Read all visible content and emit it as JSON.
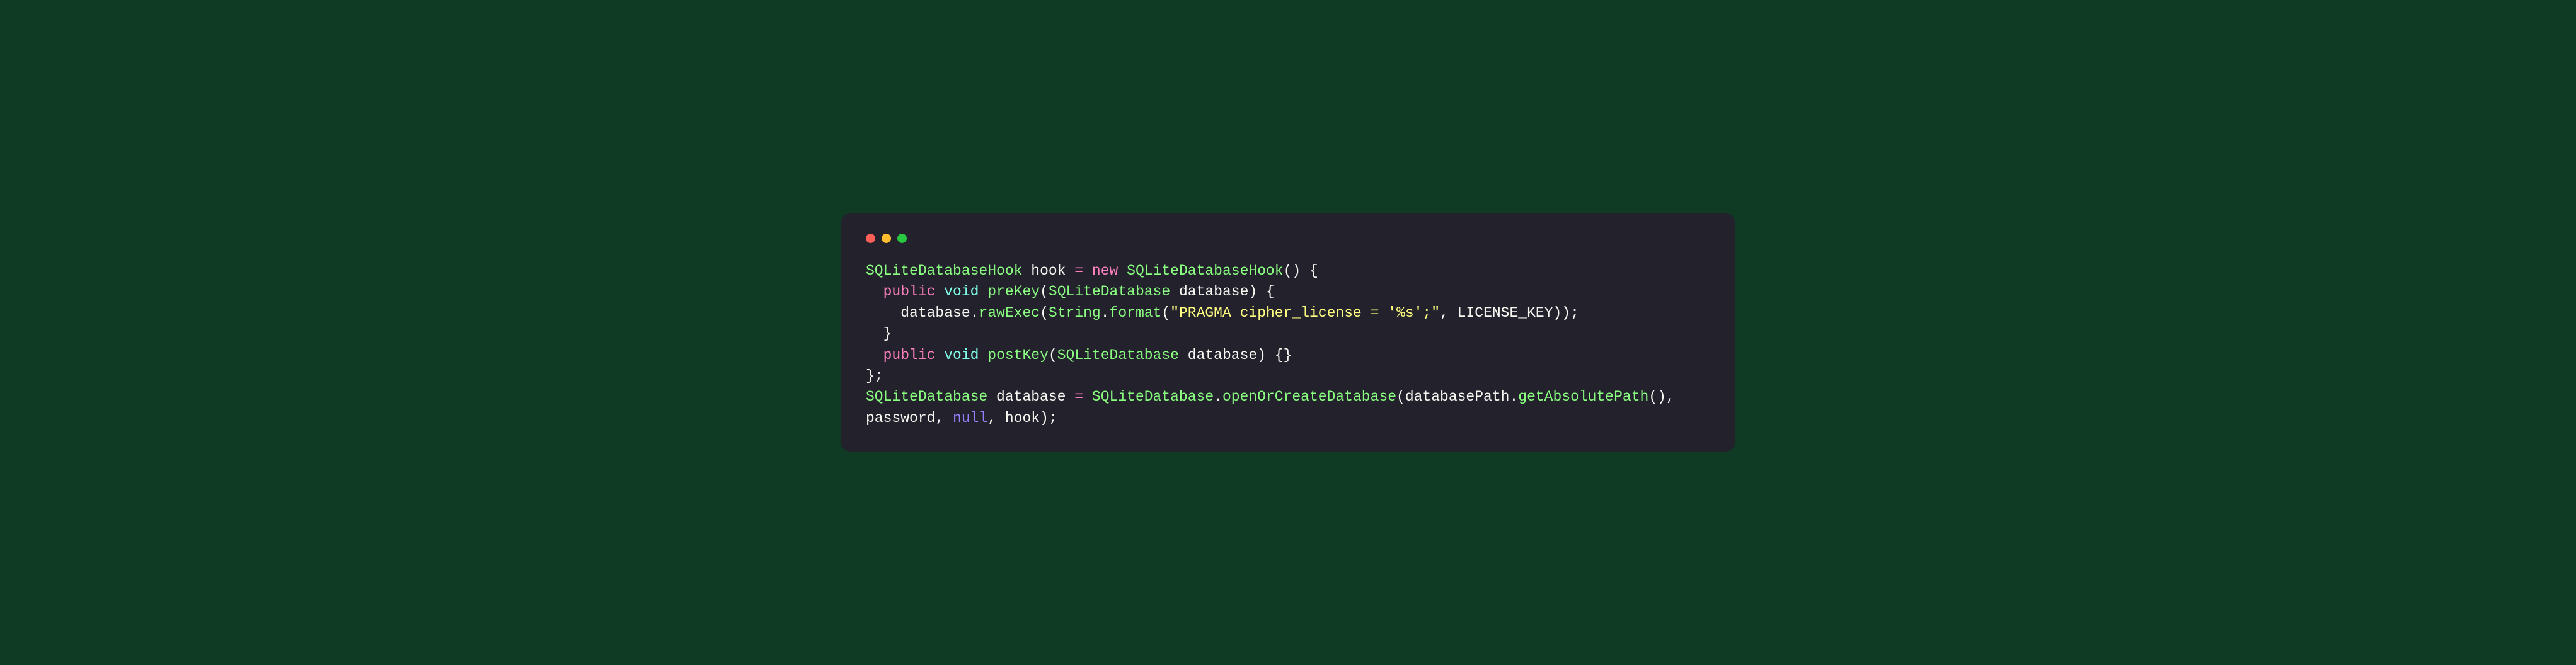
{
  "tokens": {
    "type_sqliteDatabaseHook": "SQLiteDatabaseHook",
    "ident_hook": "hook",
    "op_assign": "=",
    "key_new": "new",
    "punc_openParen": "(",
    "punc_closeParen": ")",
    "punc_openBrace": "{",
    "punc_closeBrace": "}",
    "key_public": "public",
    "builtin_void": "void",
    "method_preKey": "preKey",
    "type_sqliteDatabase": "SQLiteDatabase",
    "ident_database": "database",
    "ident_databaseDot": "database.",
    "method_rawExec": "rawExec",
    "type_string": "String",
    "method_format": "format",
    "string_pragma": "\"PRAGMA cipher_license = '%s';\"",
    "punc_comma": ",",
    "const_licenseKey": "LICENSE_KEY",
    "punc_closeParenParen": "))",
    "punc_semi": ";",
    "method_postKey": "postKey",
    "punc_emptyBlock": "{}",
    "punc_closeBraceSemi": "};",
    "method_openOrCreate": "openOrCreateDatabase",
    "ident_databasePath": "databasePath",
    "method_getAbsolutePath": "getAbsolutePath",
    "punc_openCloseParen": "()",
    "ident_password": "password",
    "key_null": "null",
    "punc_dot": "."
  }
}
